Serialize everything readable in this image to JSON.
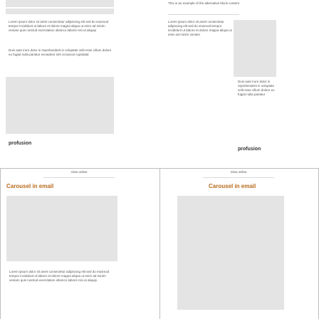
{
  "top_left": {
    "paragraph_1": "Lorem ipsum dolor sit amet consectetur adipiscing elit sed do eiusmod tempor incididunt ut labore et dolore magna aliqua ut enim ad minim veniam quis nostrud exercitation ullamco laboris nisi ut aliquip",
    "paragraph_2": "Duis aute irure dolor in reprehenderit in voluptate velit esse cillum dolore eu fugiat nulla pariatur excepteur sint occaecat cupidatat",
    "label": "profusion"
  },
  "top_right": {
    "caption": "This is an example of the alternative block content",
    "paragraph_1": "Lorem ipsum dolor sit amet consectetur adipiscing elit sed do eiusmod tempor incididunt ut labore et dolore magna aliqua ut enim ad minim veniam",
    "paragraph_2": "Duis aute irure dolor in reprehenderit in voluptate velit esse cillum dolore eu fugiat nulla pariatur",
    "label": "profusion"
  },
  "bottom_left": {
    "caption": "View online",
    "title": "Carousel in email",
    "paragraph": "Lorem ipsum dolor sit amet consectetur adipiscing elit sed do eiusmod tempor incididunt ut labore et dolore magna aliqua ut enim ad minim veniam quis nostrud exercitation ullamco laboris nisi ut aliquip"
  },
  "bottom_right": {
    "caption": "View online",
    "title": "Carousel in email"
  },
  "colors": {
    "accent": "#b86a1a",
    "divider": "#bdbdbd",
    "placeholder": "#e4e4e4"
  }
}
